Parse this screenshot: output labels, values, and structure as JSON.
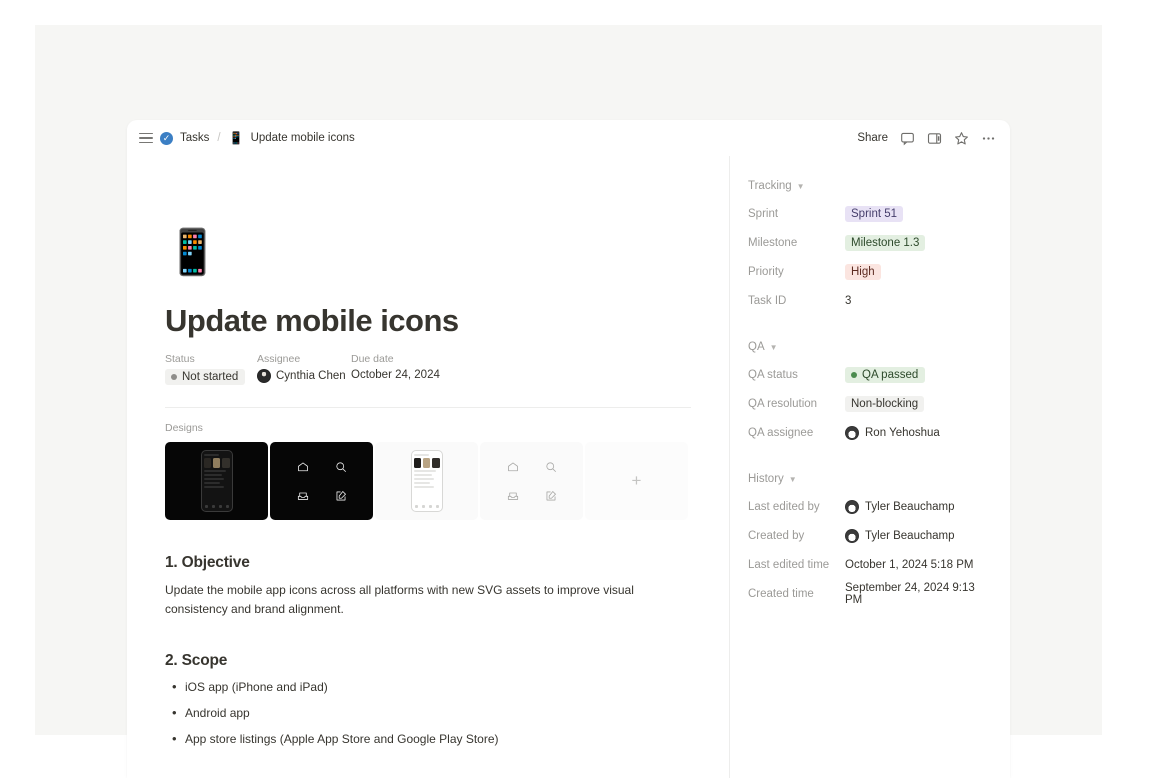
{
  "topbar": {
    "menu_icon": "hamburger-icon",
    "breadcrumb_parent": "Tasks",
    "breadcrumb_separator": "/",
    "breadcrumb_emoji": "📱",
    "breadcrumb_current": "Update mobile icons",
    "share_label": "Share",
    "icons": [
      "comment-icon",
      "sidebar-panel-icon",
      "star-icon",
      "more-options-icon"
    ]
  },
  "page": {
    "emoji": "📱",
    "title": "Update mobile icons",
    "properties": [
      {
        "label": "Status",
        "value": "Not started",
        "type": "status-pill",
        "dot_color": "#8e8d8a"
      },
      {
        "label": "Assignee",
        "value": "Cynthia Chen",
        "type": "person"
      },
      {
        "label": "Due date",
        "value": "October 24, 2024",
        "type": "text"
      }
    ],
    "designs": {
      "label": "Designs",
      "cards": [
        {
          "kind": "phone-dark",
          "name": "design-card-dark-phone"
        },
        {
          "kind": "icons-dark",
          "name": "design-card-dark-icons"
        },
        {
          "kind": "phone-light",
          "name": "design-card-light-phone"
        },
        {
          "kind": "icons-light",
          "name": "design-card-light-icons"
        },
        {
          "kind": "add",
          "name": "design-card-add",
          "label": "+"
        }
      ],
      "icon_set": [
        "home-icon",
        "search-icon",
        "mail-icon",
        "compose-icon"
      ]
    },
    "sections": [
      {
        "heading": "1. Objective",
        "paragraph": "Update the mobile app icons across all platforms with new SVG assets to improve visual consistency and brand alignment."
      },
      {
        "heading": "2. Scope",
        "bullets": [
          "iOS app (iPhone and iPad)",
          "Android app",
          "App store listings (Apple App Store and Google Play Store)"
        ]
      }
    ]
  },
  "sidepanel": {
    "sections": [
      {
        "title": "Tracking",
        "rows": [
          {
            "key": "Sprint",
            "value": "Sprint 51",
            "style": "tag-purple"
          },
          {
            "key": "Milestone",
            "value": "Milestone 1.3",
            "style": "tag-green"
          },
          {
            "key": "Priority",
            "value": "High",
            "style": "tag-red"
          },
          {
            "key": "Task ID",
            "value": "3",
            "style": "plain"
          }
        ]
      },
      {
        "title": "QA",
        "rows": [
          {
            "key": "QA status",
            "value": "QA passed",
            "style": "tag-dotgreen",
            "dot_color": "#4b8b4e"
          },
          {
            "key": "QA resolution",
            "value": "Non-blocking",
            "style": "tag-gray"
          },
          {
            "key": "QA assignee",
            "value": "Ron Yehoshua",
            "style": "person"
          }
        ]
      },
      {
        "title": "History",
        "rows": [
          {
            "key": "Last edited by",
            "value": "Tyler Beauchamp",
            "style": "person"
          },
          {
            "key": "Created by",
            "value": "Tyler Beauchamp",
            "style": "person"
          },
          {
            "key": "Last edited time",
            "value": "October 1, 2024 5:18 PM",
            "style": "plain"
          },
          {
            "key": "Created time",
            "value": "September 24, 2024 9:13 PM",
            "style": "plain"
          }
        ]
      }
    ]
  },
  "colors": {
    "accent_blue": "#3b7fc4",
    "purple_tag": "#e8e2f5",
    "green_tag": "#e3efe1",
    "red_tag": "#fbe5e0",
    "backdrop": "#f6f6f4"
  }
}
